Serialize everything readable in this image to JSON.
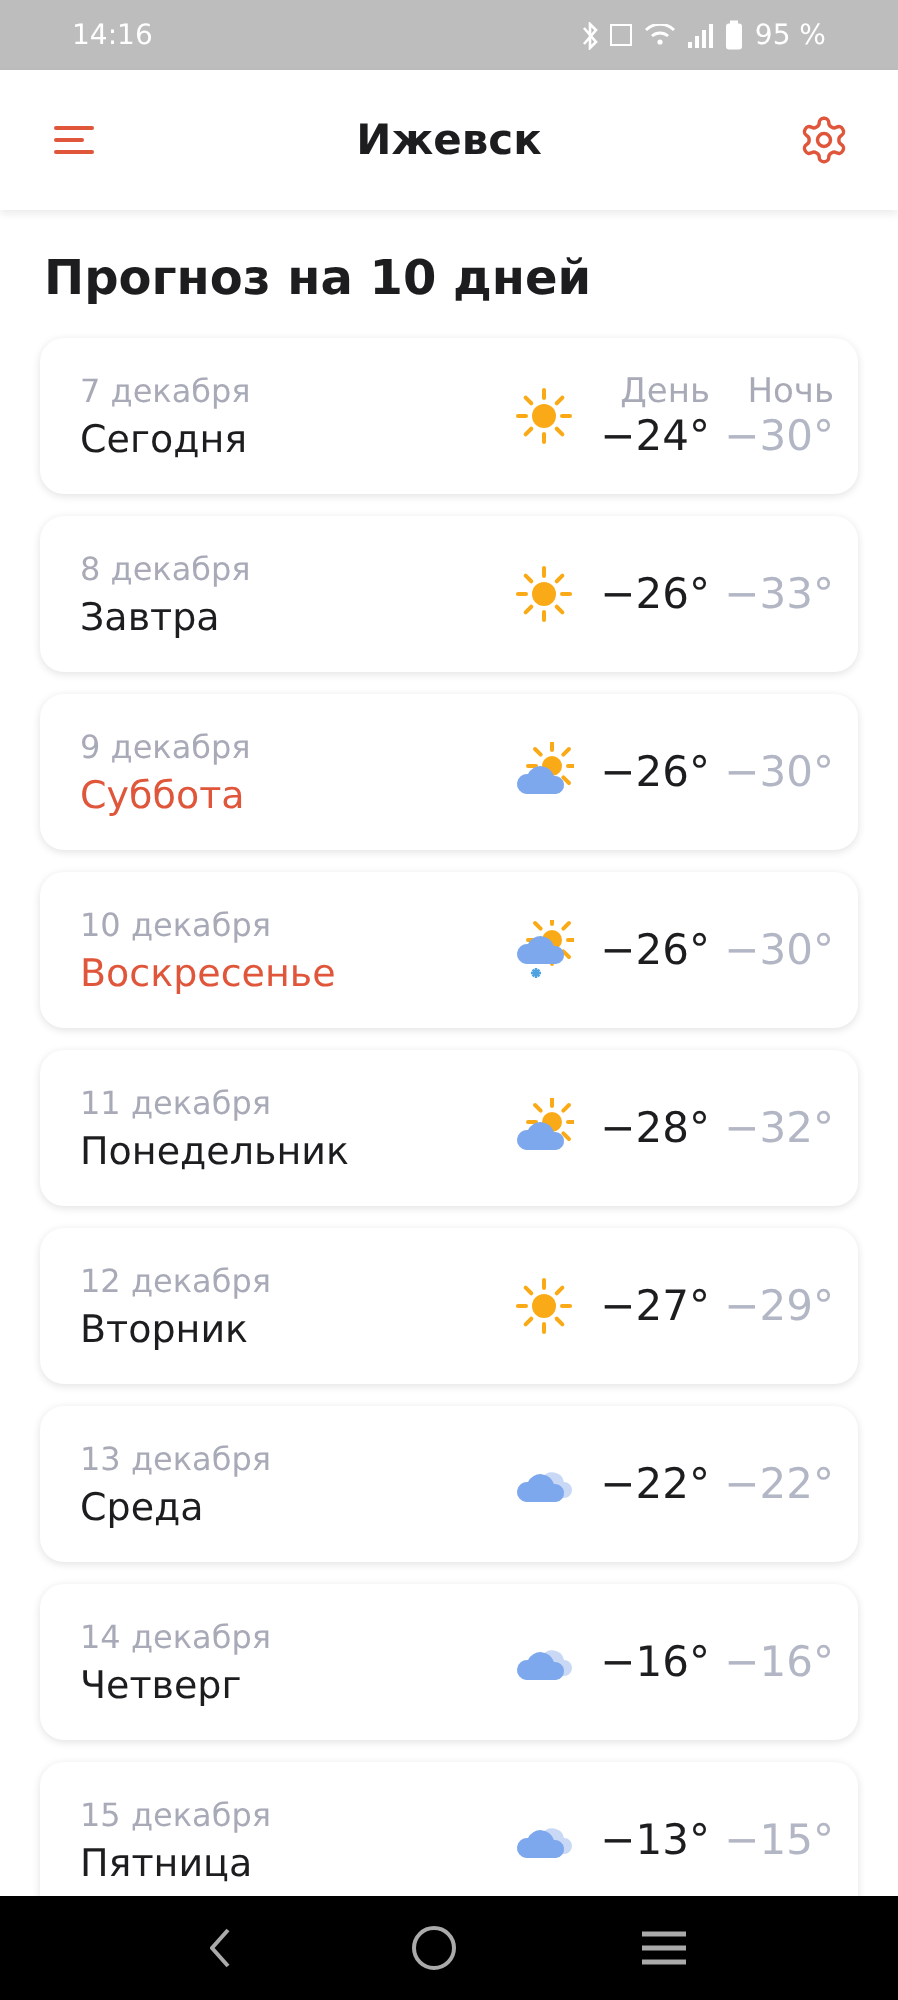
{
  "status_bar": {
    "time": "14:16",
    "battery": "95 %"
  },
  "header": {
    "title": "Ижевск"
  },
  "page_title": "Прогноз на 10 дней",
  "columns": {
    "day": "День",
    "night": "Ночь"
  },
  "days": [
    {
      "date": "7 декабря",
      "name": "Сегодня",
      "weekend": false,
      "weather": {
        "kind": "sun"
      },
      "day": "−24°",
      "night": "−30°"
    },
    {
      "date": "8 декабря",
      "name": "Завтра",
      "weekend": false,
      "weather": {
        "kind": "sun"
      },
      "day": "−26°",
      "night": "−33°"
    },
    {
      "date": "9 декабря",
      "name": "Суббота",
      "weekend": true,
      "weather": {
        "kind": "partly-cloudy"
      },
      "day": "−26°",
      "night": "−30°"
    },
    {
      "date": "10 декабря",
      "name": "Воскресенье",
      "weekend": true,
      "weather": {
        "kind": "snow"
      },
      "day": "−26°",
      "night": "−30°"
    },
    {
      "date": "11 декабря",
      "name": "Понедельник",
      "weekend": false,
      "weather": {
        "kind": "partly-cloudy"
      },
      "day": "−28°",
      "night": "−32°"
    },
    {
      "date": "12 декабря",
      "name": "Вторник",
      "weekend": false,
      "weather": {
        "kind": "sun"
      },
      "day": "−27°",
      "night": "−29°"
    },
    {
      "date": "13 декабря",
      "name": "Среда",
      "weekend": false,
      "weather": {
        "kind": "cloudy"
      },
      "day": "−22°",
      "night": "−22°"
    },
    {
      "date": "14 декабря",
      "name": "Четверг",
      "weekend": false,
      "weather": {
        "kind": "cloudy"
      },
      "day": "−16°",
      "night": "−16°"
    },
    {
      "date": "15 декабря",
      "name": "Пятница",
      "weekend": false,
      "weather": {
        "kind": "cloudy"
      },
      "day": "−13°",
      "night": "−15°"
    }
  ]
}
